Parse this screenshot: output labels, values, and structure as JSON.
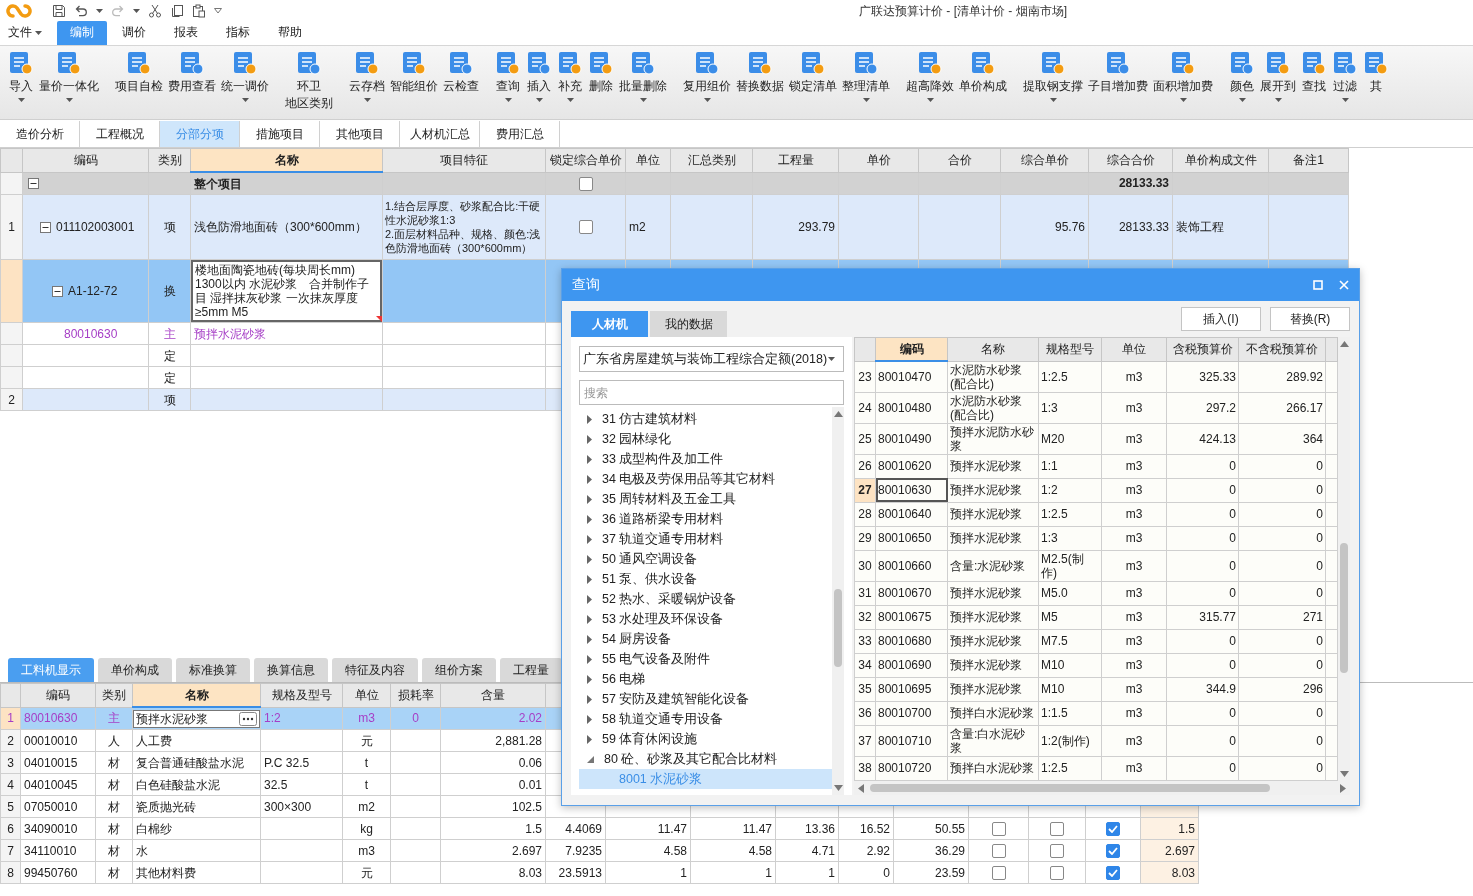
{
  "app": {
    "title": "广联达预算计价 - [清单计价 - 烟南市场]"
  },
  "menu": [
    {
      "label": "文件",
      "has_menu": true,
      "selected": false
    },
    {
      "label": "编制",
      "has_menu": false,
      "selected": true
    },
    {
      "label": "调价",
      "has_menu": false,
      "selected": false
    },
    {
      "label": "报表",
      "has_menu": false,
      "selected": false
    },
    {
      "label": "指标",
      "has_menu": false,
      "selected": false
    },
    {
      "label": "帮助",
      "has_menu": false,
      "selected": false
    }
  ],
  "ribbon": {
    "groups": [
      [
        {
          "lines": [
            "导入"
          ],
          "has_menu": true
        },
        {
          "lines": [
            "量价一体化"
          ],
          "has_menu": true
        }
      ],
      [
        {
          "lines": [
            "项目自检"
          ],
          "has_menu": false
        },
        {
          "lines": [
            "费用查看"
          ],
          "has_menu": false
        },
        {
          "lines": [
            "统一调价"
          ],
          "has_menu": true
        }
      ],
      [
        {
          "lines": [
            "环卫",
            "地区类别"
          ],
          "has_menu": false
        }
      ],
      [
        {
          "lines": [
            "云存档"
          ],
          "has_menu": true
        },
        {
          "lines": [
            "智能组价"
          ],
          "has_menu": false
        },
        {
          "lines": [
            "云检查"
          ],
          "has_menu": false
        }
      ],
      [
        {
          "lines": [
            "查询"
          ],
          "has_menu": true
        },
        {
          "lines": [
            "插入"
          ],
          "has_menu": true
        },
        {
          "lines": [
            "补充"
          ],
          "has_menu": true
        },
        {
          "lines": [
            "删除"
          ],
          "has_menu": false
        },
        {
          "lines": [
            "批量删除"
          ],
          "has_menu": true
        }
      ],
      [
        {
          "lines": [
            "复用组价"
          ],
          "has_menu": true
        },
        {
          "lines": [
            "替换数据"
          ],
          "has_menu": false
        },
        {
          "lines": [
            "锁定清单"
          ],
          "has_menu": false
        },
        {
          "lines": [
            "整理清单"
          ],
          "has_menu": true
        }
      ],
      [
        {
          "lines": [
            "超高降效"
          ],
          "has_menu": true
        },
        {
          "lines": [
            "单价构成"
          ],
          "has_menu": false
        }
      ],
      [
        {
          "lines": [
            "提取钢支撑"
          ],
          "has_menu": true
        },
        {
          "lines": [
            "子目增加费"
          ],
          "has_menu": false
        },
        {
          "lines": [
            "面积增加费"
          ],
          "has_menu": true
        }
      ],
      [
        {
          "lines": [
            "颜色"
          ],
          "has_menu": true
        },
        {
          "lines": [
            "展开到"
          ],
          "has_menu": true
        },
        {
          "lines": [
            "查找"
          ],
          "has_menu": false
        },
        {
          "lines": [
            "过滤"
          ],
          "has_menu": true
        },
        {
          "lines": [
            "其"
          ],
          "has_menu": false
        }
      ]
    ]
  },
  "view_tabs": [
    {
      "label": "造价分析",
      "selected": false
    },
    {
      "label": "工程概况",
      "selected": false
    },
    {
      "label": "分部分项",
      "selected": true
    },
    {
      "label": "措施项目",
      "selected": false
    },
    {
      "label": "其他项目",
      "selected": false
    },
    {
      "label": "人材机汇总",
      "selected": false
    },
    {
      "label": "费用汇总",
      "selected": false
    }
  ],
  "main_table": {
    "columns": [
      {
        "kind": "tree",
        "label": "编码",
        "selected": false
      },
      {
        "kind": "center",
        "label": "类别",
        "selected": false
      },
      {
        "kind": "text",
        "label": "名称",
        "selected": true
      },
      {
        "kind": "text",
        "label": "项目特征",
        "selected": false
      },
      {
        "kind": "check",
        "label": "锁定综合单价",
        "selected": false
      },
      {
        "kind": "text",
        "label": "单位",
        "selected": false
      },
      {
        "kind": "text",
        "label": "汇总类别",
        "selected": false
      },
      {
        "kind": "num",
        "label": "工程量",
        "selected": false
      },
      {
        "kind": "num",
        "label": "单价",
        "selected": false
      },
      {
        "kind": "num",
        "label": "合价",
        "selected": false
      },
      {
        "kind": "num",
        "label": "综合单价",
        "selected": false
      },
      {
        "kind": "num",
        "label": "综合合价",
        "selected": false
      },
      {
        "kind": "text",
        "label": "单价构成文件",
        "selected": false
      },
      {
        "kind": "text",
        "label": "备注1",
        "selected": false
      }
    ],
    "rows": [
      {
        "kind": "whole",
        "name": "整个项目",
        "locked": false,
        "composite_total": "28133.33",
        "expanded": true,
        "selected": false,
        "editing": false,
        "children": [
          {
            "kind": "item",
            "no": "1",
            "code": "011102003001",
            "expanded": true,
            "type": "项",
            "name": "浅色防滑地面砖（300*600mm）",
            "feature": "1.结合层厚度、砂浆配合比:干硬性水泥砂浆1:3\n2.面层材料品种、规格、颜色:浅色防滑地面砖（300*600mm）",
            "locked": false,
            "unit": "m2",
            "qty": "293.79",
            "composite_price": "95.76",
            "composite_total": "28133.33",
            "price_file": "装饰工程",
            "selected": false,
            "editing": false,
            "children": [
              {
                "kind": "sub",
                "code": "A1-12-72",
                "expanded": true,
                "type": "换",
                "name": "楼地面陶瓷地砖(每块周长mm) 1300以内 水泥砂浆　合并制作子目 湿拌抹灰砂浆 一次抹灰厚度≥5mm M5",
                "selected": true,
                "editing": true,
                "children": [
                  {
                    "kind": "material",
                    "code": "80010630",
                    "type": "主",
                    "name": "预拌水泥砂浆",
                    "selected": false,
                    "editing": false
                  }
                ]
              },
              {
                "kind": "quota",
                "type": "定",
                "selected": false,
                "editing": false
              },
              {
                "kind": "quota",
                "type": "定",
                "selected": false,
                "editing": false
              }
            ]
          },
          {
            "kind": "item",
            "no": "2",
            "type": "项",
            "selected": false,
            "editing": false
          }
        ]
      }
    ]
  },
  "detail_tabs": [
    {
      "label": "工料机显示",
      "selected": true
    },
    {
      "label": "单价构成",
      "selected": false
    },
    {
      "label": "标准换算",
      "selected": false
    },
    {
      "label": "换算信息",
      "selected": false
    },
    {
      "label": "特征及内容",
      "selected": false
    },
    {
      "label": "组价方案",
      "selected": false
    },
    {
      "label": "工程量",
      "selected": false
    }
  ],
  "detail_table": {
    "columns": [
      {
        "kind": "text",
        "label": "编码",
        "selected": false
      },
      {
        "kind": "center",
        "label": "类别",
        "selected": false
      },
      {
        "kind": "text",
        "label": "名称",
        "selected": true
      },
      {
        "kind": "text",
        "label": "规格及型号",
        "selected": false
      },
      {
        "kind": "center",
        "label": "单位",
        "selected": false
      },
      {
        "kind": "center",
        "label": "损耗率",
        "selected": false
      },
      {
        "kind": "num",
        "label": "含量",
        "selected": false
      }
    ],
    "rows": [
      {
        "kind": "main",
        "no": "1",
        "code": "80010630",
        "type": "主",
        "name": "预拌水泥砂浆",
        "spec": "1:2",
        "unit": "m3",
        "loss": "0",
        "content": "2.02",
        "selected": true,
        "editing": true
      },
      {
        "kind": "resource",
        "no": "2",
        "code": "00010010",
        "type": "人",
        "name": "人工费",
        "unit": "元",
        "content": "2,881.28",
        "selected": false,
        "editing": false
      },
      {
        "kind": "resource",
        "no": "3",
        "code": "04010015",
        "type": "材",
        "name": "复合普通硅酸盐水泥",
        "spec": "P.C 32.5",
        "unit": "t",
        "content": "0.06",
        "selected": false,
        "editing": false
      },
      {
        "kind": "resource",
        "no": "4",
        "code": "04010045",
        "type": "材",
        "name": "白色硅酸盐水泥",
        "spec": "32.5",
        "unit": "t",
        "content": "0.01",
        "selected": false,
        "editing": false
      },
      {
        "kind": "resource",
        "no": "5",
        "code": "07050010",
        "type": "材",
        "name": "瓷质抛光砖",
        "spec": "300×300",
        "unit": "m2",
        "content": "102.5",
        "selected": false,
        "editing": false
      },
      {
        "kind": "resource",
        "no": "6",
        "code": "34090010",
        "type": "材",
        "name": "白棉纱",
        "unit": "kg",
        "content": "1.5",
        "column_8": "4.4069",
        "column_9": "11.47",
        "column_10": "11.47",
        "column_11": "13.36",
        "column_12": "16.52",
        "column_13": "50.55",
        "column_14": false,
        "column_15": false,
        "column_16": true,
        "column_17": "1.5",
        "selected": false,
        "editing": false
      },
      {
        "kind": "resource",
        "no": "7",
        "code": "34110010",
        "type": "材",
        "name": "水",
        "unit": "m3",
        "content": "2.697",
        "column_8": "7.9235",
        "column_9": "4.58",
        "column_10": "4.58",
        "column_11": "4.71",
        "column_12": "2.92",
        "column_13": "36.29",
        "column_14": false,
        "column_15": false,
        "column_16": true,
        "column_17": "2.697",
        "selected": false,
        "editing": false
      },
      {
        "kind": "resource",
        "no": "8",
        "code": "99450760",
        "type": "材",
        "name": "其他材料费",
        "unit": "元",
        "content": "8.03",
        "column_8": "23.5913",
        "column_9": "1",
        "column_10": "1",
        "column_11": "1",
        "column_12": "0",
        "column_13": "23.59",
        "column_14": false,
        "column_15": false,
        "column_16": true,
        "column_17": "8.03",
        "selected": false,
        "editing": false
      }
    ]
  },
  "query_dialog": {
    "title": "查询",
    "tabs": [
      {
        "label": "人材机",
        "selected": true
      },
      {
        "label": "我的数据",
        "selected": false
      }
    ],
    "buttons": [
      "插入(I)",
      "替换(R)"
    ],
    "library": "广东省房屋建筑与装饰工程综合定额(2018)",
    "search": {
      "placeholder": "搜索"
    },
    "tree": [
      {
        "label": "31 仿古建筑材料",
        "expanded": false,
        "selected": false
      },
      {
        "label": "32 园林绿化",
        "expanded": false,
        "selected": false
      },
      {
        "label": "33 成型构件及加工件",
        "expanded": false,
        "selected": false
      },
      {
        "label": "34 电极及劳保用品等其它材料",
        "expanded": false,
        "selected": false
      },
      {
        "label": "35 周转材料及五金工具",
        "expanded": false,
        "selected": false
      },
      {
        "label": "36 道路桥梁专用材料",
        "expanded": false,
        "selected": false
      },
      {
        "label": "37 轨道交通专用材料",
        "expanded": false,
        "selected": false
      },
      {
        "label": "50 通风空调设备",
        "expanded": false,
        "selected": false
      },
      {
        "label": "51 泵、供水设备",
        "expanded": false,
        "selected": false
      },
      {
        "label": "52 热水、采暖锅炉设备",
        "expanded": false,
        "selected": false
      },
      {
        "label": "53 水处理及环保设备",
        "expanded": false,
        "selected": false
      },
      {
        "label": "54 厨房设备",
        "expanded": false,
        "selected": false
      },
      {
        "label": "55 电气设备及附件",
        "expanded": false,
        "selected": false
      },
      {
        "label": "56 电梯",
        "expanded": false,
        "selected": false
      },
      {
        "label": "57 安防及建筑智能化设备",
        "expanded": false,
        "selected": false
      },
      {
        "label": "58 轨道交通专用设备",
        "expanded": false,
        "selected": false
      },
      {
        "label": "59 体育休闲设施",
        "expanded": false,
        "selected": false
      },
      {
        "label": "80 砼、砂浆及其它配合比材料",
        "expanded": true,
        "selected": false,
        "children": [
          {
            "label": "8001 水泥砂浆",
            "selected": true
          }
        ]
      }
    ],
    "table": {
      "columns": [
        {
          "label": "编码",
          "selected": true
        },
        {
          "label": "名称",
          "selected": false
        },
        {
          "label": "规格型号",
          "selected": false
        },
        {
          "label": "单位",
          "selected": false
        },
        {
          "label": "含税预算价",
          "selected": false
        },
        {
          "label": "不含税预算价",
          "selected": false
        }
      ],
      "rows": [
        {
          "no": "23",
          "code": "80010470",
          "name": "水泥防水砂浆(配合比)",
          "spec": "1:2.5",
          "unit": "m3",
          "price_tax": "325.33",
          "price_net": "289.92",
          "selected": false
        },
        {
          "no": "24",
          "code": "80010480",
          "name": "水泥防水砂浆(配合比)",
          "spec": "1:3",
          "unit": "m3",
          "price_tax": "297.2",
          "price_net": "266.17",
          "selected": false
        },
        {
          "no": "25",
          "code": "80010490",
          "name": "预拌水泥防水砂浆",
          "spec": "M20",
          "unit": "m3",
          "price_tax": "424.13",
          "price_net": "364",
          "selected": false
        },
        {
          "no": "26",
          "code": "80010620",
          "name": "预拌水泥砂浆",
          "spec": "1:1",
          "unit": "m3",
          "price_tax": "0",
          "price_net": "0",
          "selected": false
        },
        {
          "no": "27",
          "code": "80010630",
          "name": "预拌水泥砂浆",
          "spec": "1:2",
          "unit": "m3",
          "price_tax": "0",
          "price_net": "0",
          "selected": true
        },
        {
          "no": "28",
          "code": "80010640",
          "name": "预拌水泥砂浆",
          "spec": "1:2.5",
          "unit": "m3",
          "price_tax": "0",
          "price_net": "0",
          "selected": false
        },
        {
          "no": "29",
          "code": "80010650",
          "name": "预拌水泥砂浆",
          "spec": "1:3",
          "unit": "m3",
          "price_tax": "0",
          "price_net": "0",
          "selected": false
        },
        {
          "no": "30",
          "code": "80010660",
          "name": "含量:水泥砂浆",
          "spec": "M2.5(制作)",
          "unit": "m3",
          "price_tax": "0",
          "price_net": "0",
          "selected": false
        },
        {
          "no": "31",
          "code": "80010670",
          "name": "预拌水泥砂浆",
          "spec": "M5.0",
          "unit": "m3",
          "price_tax": "0",
          "price_net": "0",
          "selected": false
        },
        {
          "no": "32",
          "code": "80010675",
          "name": "预拌水泥砂浆",
          "spec": "M5",
          "unit": "m3",
          "price_tax": "315.77",
          "price_net": "271",
          "selected": false
        },
        {
          "no": "33",
          "code": "80010680",
          "name": "预拌水泥砂浆",
          "spec": "M7.5",
          "unit": "m3",
          "price_tax": "0",
          "price_net": "0",
          "selected": false
        },
        {
          "no": "34",
          "code": "80010690",
          "name": "预拌水泥砂浆",
          "spec": "M10",
          "unit": "m3",
          "price_tax": "0",
          "price_net": "0",
          "selected": false
        },
        {
          "no": "35",
          "code": "80010695",
          "name": "预拌水泥砂浆",
          "spec": "M10",
          "unit": "m3",
          "price_tax": "344.9",
          "price_net": "296",
          "selected": false
        },
        {
          "no": "36",
          "code": "80010700",
          "name": "预拌白水泥砂浆",
          "spec": "1:1.5",
          "unit": "m3",
          "price_tax": "0",
          "price_net": "0",
          "selected": false
        },
        {
          "no": "37",
          "code": "80010710",
          "name": "含量:白水泥砂浆",
          "spec": "1:2(制作)",
          "unit": "m3",
          "price_tax": "0",
          "price_net": "0",
          "selected": false
        },
        {
          "no": "38",
          "code": "80010720",
          "name": "预拌白水泥砂浆",
          "spec": "1:2.5",
          "unit": "m3",
          "price_tax": "0",
          "price_net": "0",
          "selected": false
        }
      ]
    }
  }
}
